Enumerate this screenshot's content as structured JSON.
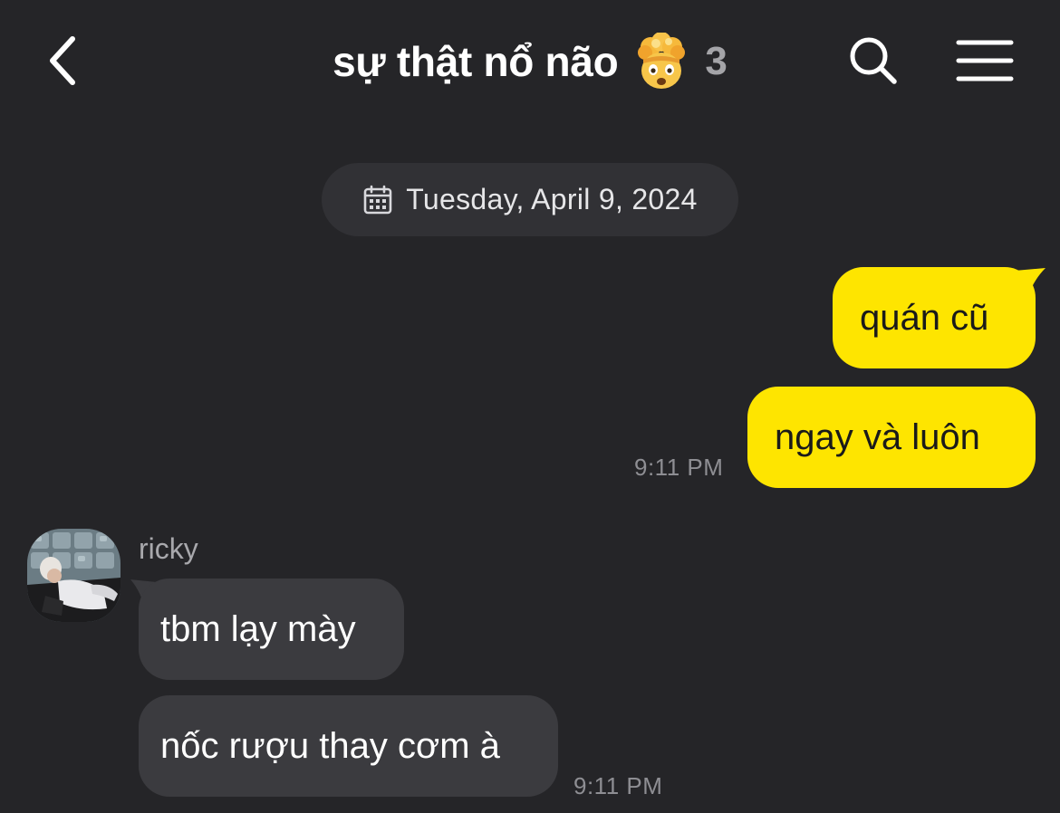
{
  "header": {
    "back_icon": "chevron-left-icon",
    "title": "sự thật nổ não",
    "title_emoji": "exploding-head-emoji",
    "member_count": "3",
    "search_icon": "search-icon",
    "menu_icon": "hamburger-menu-icon"
  },
  "date_separator": {
    "icon": "calendar-icon",
    "text": "Tuesday, April 9, 2024"
  },
  "messages": [
    {
      "direction": "outgoing",
      "text": "quán cũ",
      "time": ""
    },
    {
      "direction": "outgoing",
      "text": "ngay và luôn",
      "time": "9:11 PM"
    },
    {
      "direction": "incoming",
      "sender": "ricky",
      "text": "tbm lạy mày",
      "time": ""
    },
    {
      "direction": "incoming",
      "sender": "ricky",
      "text": "nốc rượu thay cơm à",
      "time": "9:11 PM"
    }
  ],
  "sender": {
    "name": "ricky"
  },
  "colors": {
    "background": "#252528",
    "outgoing_bubble": "#fee500",
    "incoming_bubble": "#3b3b3f",
    "date_chip": "#313135",
    "timestamp": "#8e8e93"
  }
}
